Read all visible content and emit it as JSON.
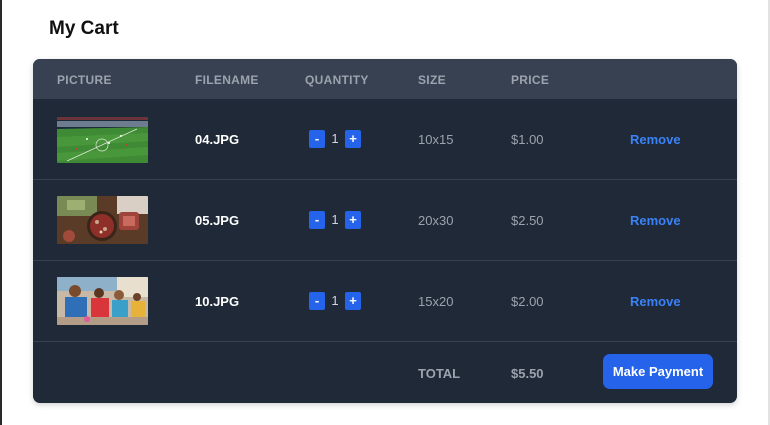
{
  "cart": {
    "title": "My Cart",
    "columns": {
      "picture": "PICTURE",
      "filename": "FILENAME",
      "quantity": "QUANTITY",
      "size": "SIZE",
      "price": "PRICE"
    },
    "items": [
      {
        "picture": "soccer-stadium-photo",
        "filename": "04.JPG",
        "quantity": "1",
        "size": "10x15",
        "price": "$1.00",
        "remove_label": "Remove"
      },
      {
        "picture": "food-platter-photo",
        "filename": "05.JPG",
        "quantity": "1",
        "size": "20x30",
        "price": "$2.50",
        "remove_label": "Remove"
      },
      {
        "picture": "group-of-people-photo",
        "filename": "10.JPG",
        "quantity": "1",
        "size": "15x20",
        "price": "$2.00",
        "remove_label": "Remove"
      }
    ],
    "decrement_label": "-",
    "increment_label": "+",
    "total_label": "TOTAL",
    "total_value": "$5.50",
    "pay_button": "Make Payment"
  },
  "colors": {
    "panel": "#1f2937",
    "header": "#374151",
    "accent": "#2563eb",
    "link": "#3b82f6",
    "muted_text": "#9ca3af"
  }
}
